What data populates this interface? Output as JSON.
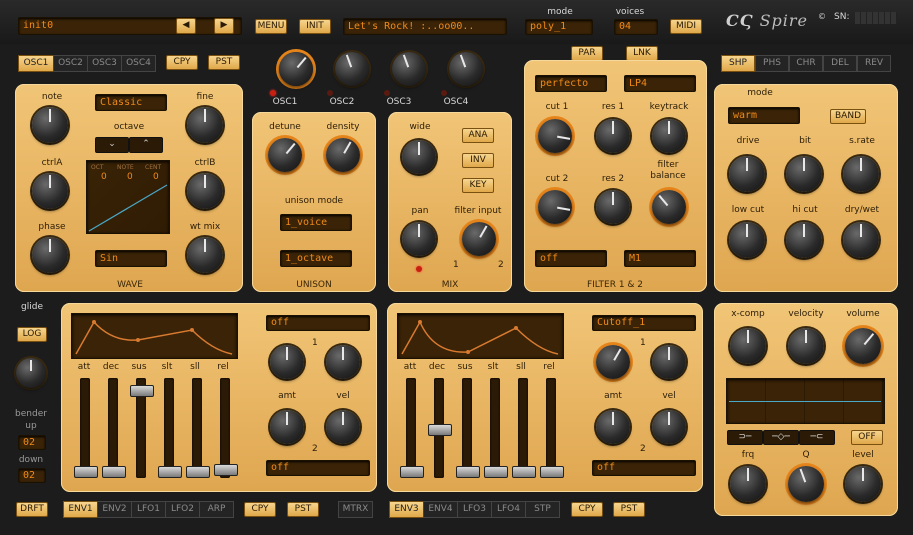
{
  "header": {
    "preset": "init0",
    "menu": "MENU",
    "init": "INIT",
    "message": "Let's Rock! :..oo00..",
    "mode_label": "mode",
    "mode_value": "poly_1",
    "voices_label": "voices",
    "voices_value": "04",
    "midi": "MIDI",
    "logo": "Spire",
    "sn": "SN:"
  },
  "osc_tabs": [
    "OSC1",
    "OSC2",
    "OSC3",
    "OSC4"
  ],
  "cpy": "CPY",
  "pst": "PST",
  "osc_mix_labels": [
    "OSC1",
    "OSC2",
    "OSC3",
    "OSC4"
  ],
  "par": "PAR",
  "lnk": "LNK",
  "fx_tabs": [
    "SHP",
    "PHS",
    "CHR",
    "DEL",
    "REV"
  ],
  "wave": {
    "note": "note",
    "fine": "fine",
    "octave": "octave",
    "ctrlA": "ctrlA",
    "ctrlB": "ctrlB",
    "phase": "phase",
    "wtmix": "wt mix",
    "type": "Classic",
    "shape": "Sin",
    "section": "WAVE",
    "oct_h": "OCT",
    "note_h": "NOTE",
    "cent_h": "CENT",
    "oct_v": "0",
    "note_v": "0",
    "cent_v": "0",
    "oct_down": "⌄",
    "oct_up": "⌃"
  },
  "unison": {
    "detune": "detune",
    "density": "density",
    "mode_label": "unison mode",
    "voice": "1_voice",
    "octave": "1_octave",
    "section": "UNISON"
  },
  "mix": {
    "wide": "wide",
    "pan": "pan",
    "filter_input": "filter input",
    "ana": "ANA",
    "inv": "INV",
    "key": "KEY",
    "section": "MIX",
    "in1": "1",
    "in2": "2"
  },
  "filter": {
    "type1": "perfecto",
    "type2": "LP4",
    "cut1": "cut 1",
    "res1": "res 1",
    "keytrack": "keytrack",
    "cut2": "cut 2",
    "res2": "res 2",
    "balance": "filter balance",
    "mode1": "off",
    "mode2": "M1",
    "section": "FILTER 1 & 2"
  },
  "shaper": {
    "mode": "mode",
    "mode_value": "warm",
    "band": "BAND",
    "drive": "drive",
    "bit": "bit",
    "srate": "s.rate",
    "lowcut": "low cut",
    "hicut": "hi cut",
    "drywet": "dry/wet"
  },
  "left": {
    "glide": "glide",
    "log": "LOG",
    "bender_up": "bender up",
    "up_val": "02",
    "down": "down",
    "down_val": "02"
  },
  "env1": {
    "labels": [
      "att",
      "dec",
      "sus",
      "slt",
      "sll",
      "rel"
    ],
    "dest1": "off",
    "dest2": "off",
    "n1": "1",
    "n2": "2",
    "amt": "amt",
    "vel": "vel",
    "faders": [
      0.0,
      0.0,
      0.92,
      0.0,
      0.0,
      0.02
    ]
  },
  "env3": {
    "labels": [
      "att",
      "dec",
      "sus",
      "slt",
      "sll",
      "rel"
    ],
    "dest1": "Cutoff_1",
    "dest2": "off",
    "n1": "1",
    "n2": "2",
    "amt": "amt",
    "vel": "vel",
    "faders": [
      0.0,
      0.48,
      0.0,
      0.0,
      0.0,
      0.0
    ]
  },
  "eq": {
    "xcomp": "x-comp",
    "velocity": "velocity",
    "volume": "volume",
    "frq": "frq",
    "q": "Q",
    "level": "level",
    "off": "OFF",
    "shape1": "⊃─",
    "shape2": "─◇─",
    "shape3": "─⊂"
  },
  "bottom": {
    "drft": "DRFT",
    "tabs1": [
      "ENV1",
      "ENV2",
      "LFO1",
      "LFO2",
      "ARP"
    ],
    "mtrx": "MTRX",
    "tabs2": [
      "ENV3",
      "ENV4",
      "LFO3",
      "LFO4",
      "STP"
    ]
  },
  "colors": {
    "accent": "#e6851b",
    "panel": "#e8b766",
    "lcd": "#3a2306",
    "lcd_text": "#f08a1a"
  }
}
